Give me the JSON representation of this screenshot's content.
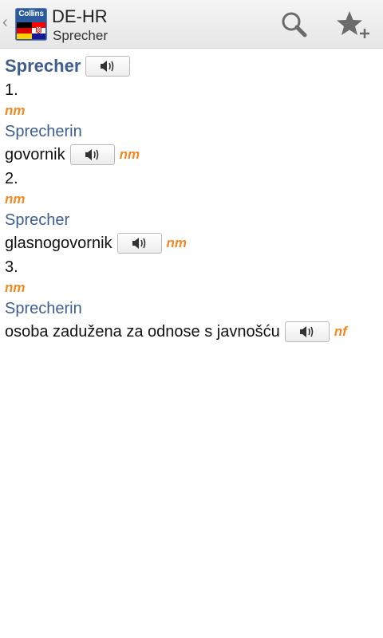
{
  "action_bar": {
    "title": "DE-HR",
    "subtitle": "Sprecher",
    "logo_text": "Collins",
    "up_icon": "chevron-left-icon",
    "search_icon": "search-icon",
    "favorite_icon": "star-add-icon"
  },
  "entry": {
    "headword": "Sprecher",
    "senses": [
      {
        "number": "1.",
        "pos": "nm",
        "source": "Sprecherin",
        "translation": "govornik",
        "translation_pos": "nm"
      },
      {
        "number": "2.",
        "pos": "nm",
        "source": "Sprecher",
        "translation": "glasnogovornik",
        "translation_pos": "nm"
      },
      {
        "number": "3.",
        "pos": "nm",
        "source": "Sprecherin",
        "translation": "osoba zadužena za odnose s javnošću",
        "translation_pos": "nf"
      }
    ]
  },
  "colors": {
    "headword": "#3d5f8f",
    "source": "#3d5f8f",
    "pos": "#f08a24",
    "text": "#111111",
    "bar_background": "#ececec"
  }
}
